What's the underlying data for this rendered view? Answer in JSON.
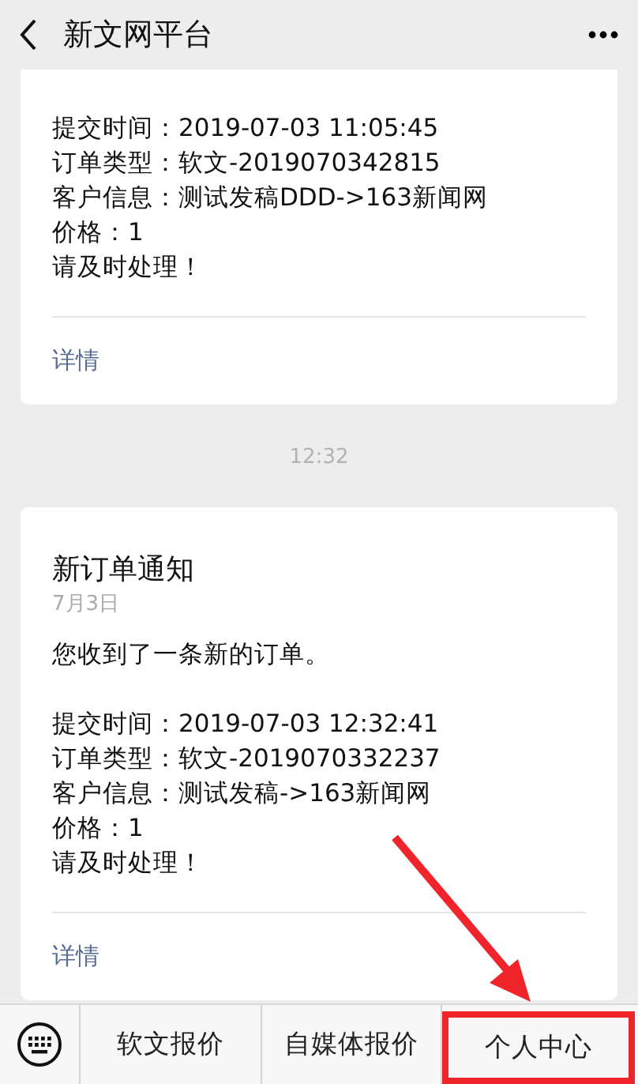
{
  "header": {
    "title": "新文网平台"
  },
  "feed": [
    {
      "kind": "card",
      "lines": [
        "提交时间：2019-07-03 11:05:45",
        "订单类型：软文-2019070342815",
        "客户信息：测试发稿DDD->163新闻网",
        "价格：1",
        "请及时处理！"
      ],
      "link": "详情"
    },
    {
      "kind": "time",
      "text": "12:32"
    },
    {
      "kind": "card",
      "title": "新订单通知",
      "date": "7月3日",
      "intro": "您收到了一条新的订单。",
      "lines": [
        "提交时间：2019-07-03 12:32:41",
        "订单类型：软文-2019070332237",
        "客户信息：测试发稿->163新闻网",
        "价格：1",
        "请及时处理！"
      ],
      "link": "详情"
    }
  ],
  "menu": [
    {
      "label": "软文报价",
      "highlighted": false
    },
    {
      "label": "自媒体报价",
      "highlighted": false
    },
    {
      "label": "个人中心",
      "highlighted": true
    }
  ]
}
